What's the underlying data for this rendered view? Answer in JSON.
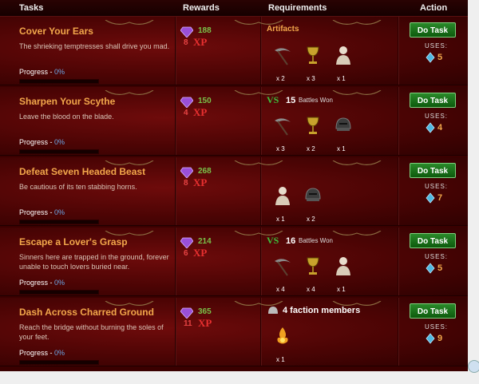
{
  "headers": {
    "tasks": "Tasks",
    "rewards": "Rewards",
    "requirements": "Requirements",
    "action": "Action"
  },
  "labels": {
    "progress": "Progress - ",
    "xp": "XP",
    "uses": "USES:",
    "do_task": "Do Task",
    "battles_won": "Battles Won"
  },
  "tasks": [
    {
      "title": "Cover Your Ears",
      "desc": "The shrieking temptresses shall drive you mad.",
      "progress": "0%",
      "gold": "188",
      "xp": "8",
      "req_header": "Artifacts",
      "vs": "",
      "battles": "",
      "faction": "",
      "items": [
        {
          "icon": "scythe-icon",
          "count": "x 2"
        },
        {
          "icon": "chalice-icon",
          "count": "x 3"
        },
        {
          "icon": "bust-icon",
          "count": "x 1"
        }
      ],
      "uses": "5"
    },
    {
      "title": "Sharpen Your Scythe",
      "desc": "Leave the blood on the blade.",
      "progress": "0%",
      "gold": "150",
      "xp": "4",
      "req_header": "",
      "vs": "VS",
      "battles": "15",
      "faction": "",
      "items": [
        {
          "icon": "scythe-icon",
          "count": "x 3"
        },
        {
          "icon": "chalice-icon",
          "count": "x 2"
        },
        {
          "icon": "helmet-icon",
          "count": "x 1"
        }
      ],
      "uses": "4"
    },
    {
      "title": "Defeat Seven Headed Beast",
      "desc": "Be cautious of its ten stabbing horns.",
      "progress": "0%",
      "gold": "268",
      "xp": "8",
      "req_header": "",
      "vs": "",
      "battles": "",
      "faction": "",
      "items": [
        {
          "icon": "bust-icon",
          "count": "x 1"
        },
        {
          "icon": "helmet-icon",
          "count": "x 2"
        }
      ],
      "uses": "7"
    },
    {
      "title": "Escape a Lover's Grasp",
      "desc": "Sinners here are trapped in the ground, forever unable to touch lovers buried near.",
      "progress": "0%",
      "gold": "214",
      "xp": "6",
      "req_header": "",
      "vs": "VS",
      "battles": "16",
      "faction": "",
      "items": [
        {
          "icon": "scythe-icon",
          "count": "x 4"
        },
        {
          "icon": "chalice-icon",
          "count": "x 4"
        },
        {
          "icon": "bust-icon",
          "count": "x 1"
        }
      ],
      "uses": "5"
    },
    {
      "title": "Dash Across Charred Ground",
      "desc": "Reach the bridge without burning the soles of your feet.",
      "progress": "0%",
      "gold": "365",
      "xp": "11",
      "req_header": "",
      "vs": "",
      "battles": "",
      "faction": "4 faction members",
      "items": [
        {
          "icon": "flame-icon",
          "count": "x 1"
        }
      ],
      "uses": "9"
    }
  ]
}
